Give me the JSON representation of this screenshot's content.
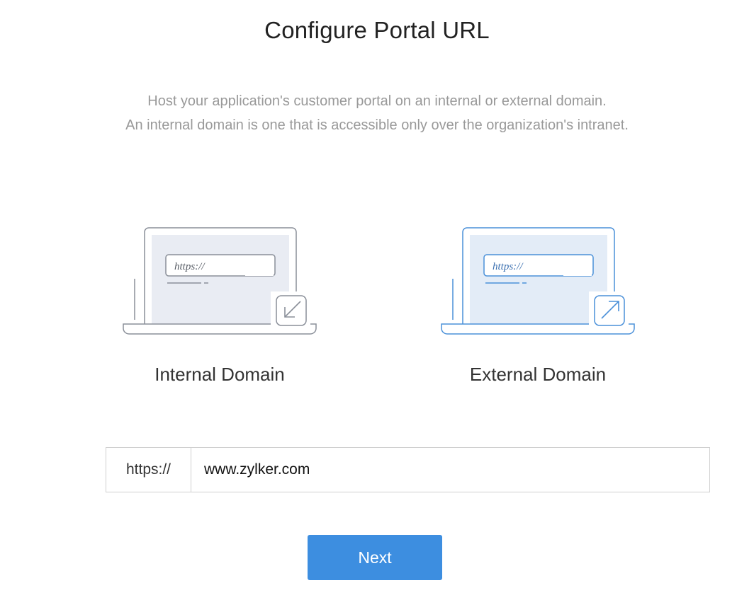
{
  "page": {
    "title": "Configure Portal URL",
    "description_line1": "Host your application's customer portal on an internal or external domain.",
    "description_line2": "An internal domain is one that is accessible only over the organization's intranet."
  },
  "options": [
    {
      "id": "internal",
      "label": "Internal Domain",
      "illustration_text": "https://",
      "icon": "arrow-down-left-icon",
      "accent_color": "#8a8f99",
      "screen_fill": "#e9ecf3"
    },
    {
      "id": "external",
      "label": "External Domain",
      "illustration_text": "https://",
      "icon": "arrow-up-right-icon",
      "accent_color": "#4a90d9",
      "screen_fill": "#e3ecf7"
    }
  ],
  "url_field": {
    "prefix": "https://",
    "value": "www.zylker.com"
  },
  "next_button": {
    "label": "Next",
    "color": "#3d8ee0"
  }
}
